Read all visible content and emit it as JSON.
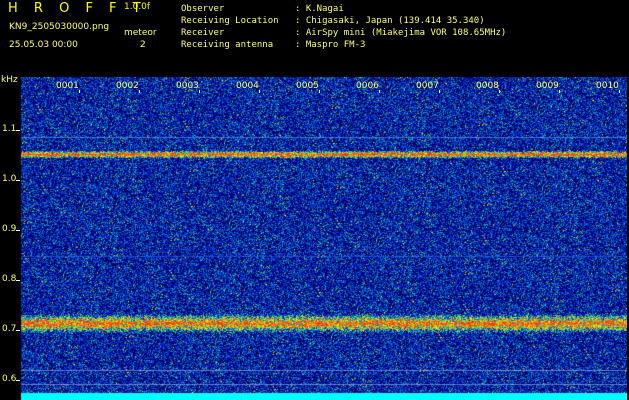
{
  "header": {
    "title": "H R O F F T",
    "version": "1.0.0f",
    "filename": "KN9_2505030000.png",
    "meteor_label": "meteor",
    "meteor_count": "2",
    "timestamp": "25.05.03 00:00",
    "info_labels": [
      "Observer",
      "Receiving Location",
      "Receiver",
      "Receiving antenna"
    ],
    "info_values": [
      ": K.Nagai",
      ": Chigasaki, Japan (139.414 35.340)",
      ": AirSpy mini (Miakejima VOR 108.65MHz)",
      ": Maspro FM-3"
    ]
  },
  "axis": {
    "y_unit": "kHz",
    "y_ticks": [
      "1.1",
      "1.0",
      "0.9",
      "0.8",
      "0.7",
      "0.6"
    ],
    "x_ticks": [
      "0001",
      "0002",
      "0003",
      "0004",
      "0005",
      "0006",
      "0007",
      "0008",
      "0009",
      "0010"
    ]
  },
  "colors": {
    "background": "#000000",
    "header_text": "#ffff66",
    "title_text": "#ffff00",
    "noise_low": "#0a1a8a",
    "band": "#ff3b1f",
    "baseline": "#00ffff"
  }
}
